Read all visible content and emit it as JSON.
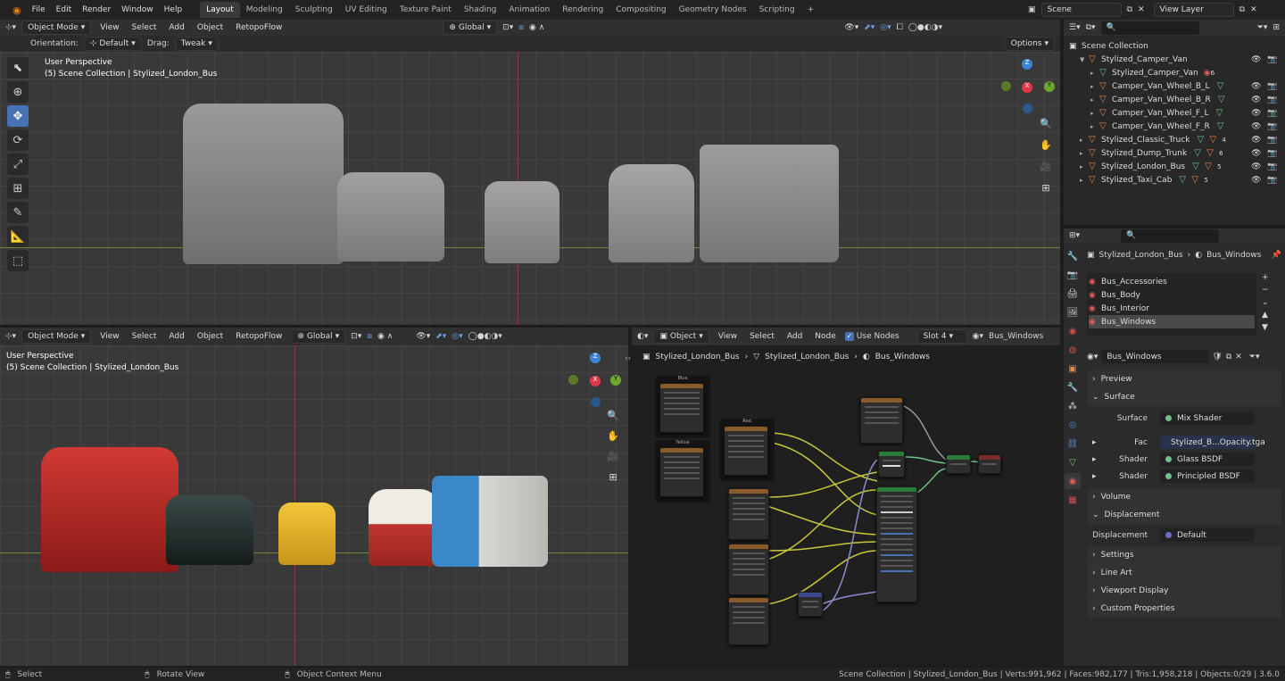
{
  "menubar": {
    "items": [
      "File",
      "Edit",
      "Render",
      "Window",
      "Help"
    ]
  },
  "workspaces": {
    "tabs": [
      "Layout",
      "Modeling",
      "Sculpting",
      "UV Editing",
      "Texture Paint",
      "Shading",
      "Animation",
      "Rendering",
      "Compositing",
      "Geometry Nodes",
      "Scripting"
    ],
    "active": "Layout",
    "add": "+"
  },
  "scene": {
    "label": "Scene",
    "view_layer": "View Layer"
  },
  "top_view": {
    "mode": "Object Mode",
    "menus": [
      "View",
      "Select",
      "Add",
      "Object"
    ],
    "addon": "RetopoFlow",
    "transform": "Global",
    "orientation_label": "Orientation:",
    "orientation": "Default",
    "drag_label": "Drag:",
    "drag": "Tweak",
    "options": "Options",
    "info_line1": "User Perspective",
    "info_line2": "(5) Scene Collection | Stylized_London_Bus"
  },
  "bottom_view": {
    "mode": "Object Mode",
    "menus": [
      "View",
      "Select",
      "Add",
      "Object"
    ],
    "addon": "RetopoFlow",
    "transform": "Global",
    "info_line1": "User Perspective",
    "info_line2": "(5) Scene Collection | Stylized_London_Bus"
  },
  "node_editor": {
    "type": "Object",
    "menus": [
      "View",
      "Select",
      "Add",
      "Node"
    ],
    "use_nodes": "Use Nodes",
    "slot": "Slot 4",
    "material": "Bus_Windows",
    "breadcrumb": [
      "Stylized_London_Bus",
      "Stylized_London_Bus",
      "Bus_Windows"
    ],
    "frame1": "Blue",
    "frame2": "Yellow",
    "frame3": "Red"
  },
  "outliner": {
    "root": "Scene Collection",
    "items": [
      {
        "name": "Stylized_Camper_Van",
        "level": 1,
        "type": "object",
        "badge": ""
      },
      {
        "name": "Stylized_Camper_Van",
        "level": 2,
        "type": "mesh",
        "badge": "6"
      },
      {
        "name": "Camper_Van_Wheel_B_L",
        "level": 2,
        "type": "object",
        "badge": ""
      },
      {
        "name": "Camper_Van_Wheel_B_R",
        "level": 2,
        "type": "object",
        "badge": ""
      },
      {
        "name": "Camper_Van_Wheel_F_L",
        "level": 2,
        "type": "object",
        "badge": ""
      },
      {
        "name": "Camper_Van_Wheel_F_R",
        "level": 2,
        "type": "object",
        "badge": ""
      },
      {
        "name": "Stylized_Classic_Truck",
        "level": 1,
        "type": "object",
        "badge": "4"
      },
      {
        "name": "Stylized_Dump_Trunk",
        "level": 1,
        "type": "object",
        "badge": "6"
      },
      {
        "name": "Stylized_London_Bus",
        "level": 1,
        "type": "object",
        "badge": "5"
      },
      {
        "name": "Stylized_Taxi_Cab",
        "level": 1,
        "type": "object",
        "badge": "5"
      }
    ]
  },
  "properties": {
    "breadcrumb_object": "Stylized_London_Bus",
    "breadcrumb_material": "Bus_Windows",
    "materials": [
      "Bus_Accessories",
      "Bus_Body",
      "Bus_Interior",
      "Bus_Windows"
    ],
    "selected_material": "Bus_Windows",
    "material_name": "Bus_Windows",
    "panels": {
      "preview": "Preview",
      "surface": "Surface",
      "volume": "Volume",
      "displacement": "Displacement",
      "settings": "Settings",
      "line_art": "Line Art",
      "viewport_display": "Viewport Display",
      "custom_properties": "Custom Properties"
    },
    "surface_label": "Surface",
    "surface_value": "Mix Shader",
    "fac_label": "Fac",
    "fac_value": "Stylized_B...Opacity.tga",
    "shader1_label": "Shader",
    "shader1_value": "Glass BSDF",
    "shader2_label": "Shader",
    "shader2_value": "Principled BSDF",
    "disp_label": "Displacement",
    "disp_value": "Default"
  },
  "statusbar": {
    "select": "Select",
    "rotate": "Rotate View",
    "context": "Object Context Menu",
    "stats": "Scene Collection | Stylized_London_Bus | Verts:991,962 | Faces:982,177 | Tris:1,958,218 | Objects:0/29 | 3.6.0"
  },
  "colors": {
    "accent": "#4772b3",
    "object": "#e3874a",
    "mesh": "#6fc187",
    "axis_x": "#e0384a",
    "axis_y": "#6ca82b",
    "axis_z": "#3b83d6"
  }
}
